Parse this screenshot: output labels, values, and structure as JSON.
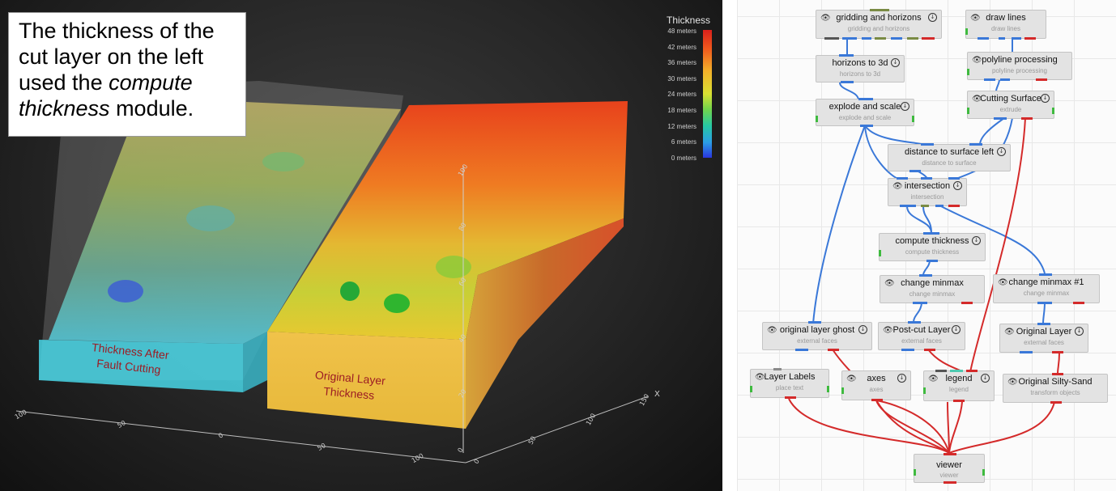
{
  "callout": {
    "line1": "The thickness of the",
    "line2": "cut layer on the left",
    "line3_pre": "used the ",
    "line3_em": "compute",
    "line4_em": "thickness",
    "line4_post": " module."
  },
  "viewport": {
    "label_left_1": "Thickness After",
    "label_left_2": "Fault Cutting",
    "label_right_1": "Original Layer",
    "label_right_2": "Thickness",
    "axis_labels_front": [
      "100",
      "50",
      "0",
      "50",
      "100"
    ],
    "axis_labels_side": [
      "0",
      "50",
      "100",
      "150"
    ],
    "axis_vertical": [
      "0",
      "20",
      "40",
      "60",
      "80",
      "100"
    ],
    "axis_x_letter": "X"
  },
  "legend": {
    "title": "Thickness",
    "ticks": [
      "48 meters",
      "42 meters",
      "36 meters",
      "30 meters",
      "24 meters",
      "18 meters",
      "12 meters",
      "6 meters",
      "0 meters"
    ]
  },
  "colors": {
    "link_blue": "#3a78d8",
    "link_red": "#d42a2a",
    "port_green": "#3fba3f",
    "label_red": "#9c1c24"
  },
  "nodes": [
    {
      "id": "gridding",
      "title": "gridding and horizons",
      "sub": "gridding and horizons"
    },
    {
      "id": "drawlines",
      "title": "draw lines",
      "sub": "draw lines"
    },
    {
      "id": "horizons3d",
      "title": "horizons to 3d",
      "sub": "horizons to 3d"
    },
    {
      "id": "polyline",
      "title": "polyline processing",
      "sub": "polyline processing"
    },
    {
      "id": "explode",
      "title": "explode and scale",
      "sub": "explode and scale"
    },
    {
      "id": "cutting",
      "title": "Cutting Surface",
      "sub": "extrude"
    },
    {
      "id": "distance",
      "title": "distance to surface left",
      "sub": "distance to surface"
    },
    {
      "id": "intersection",
      "title": "intersection",
      "sub": "intersection"
    },
    {
      "id": "computethick",
      "title": "compute thickness",
      "sub": "compute thickness"
    },
    {
      "id": "changeminmax",
      "title": "change minmax",
      "sub": "change minmax"
    },
    {
      "id": "changeminmax1",
      "title": "change minmax #1",
      "sub": "change minmax"
    },
    {
      "id": "origghost",
      "title": "original layer ghost",
      "sub": "external faces"
    },
    {
      "id": "postcut",
      "title": "Post-cut Layer",
      "sub": "external faces"
    },
    {
      "id": "origlayer",
      "title": "Original Layer",
      "sub": "external faces"
    },
    {
      "id": "labels",
      "title": "Layer Labels",
      "sub": "place text"
    },
    {
      "id": "axes",
      "title": "axes",
      "sub": "axes"
    },
    {
      "id": "legend",
      "title": "legend",
      "sub": "legend"
    },
    {
      "id": "silty",
      "title": "Original Silty-Sand",
      "sub": "transform objects"
    },
    {
      "id": "viewer",
      "title": "viewer",
      "sub": "viewer"
    }
  ]
}
